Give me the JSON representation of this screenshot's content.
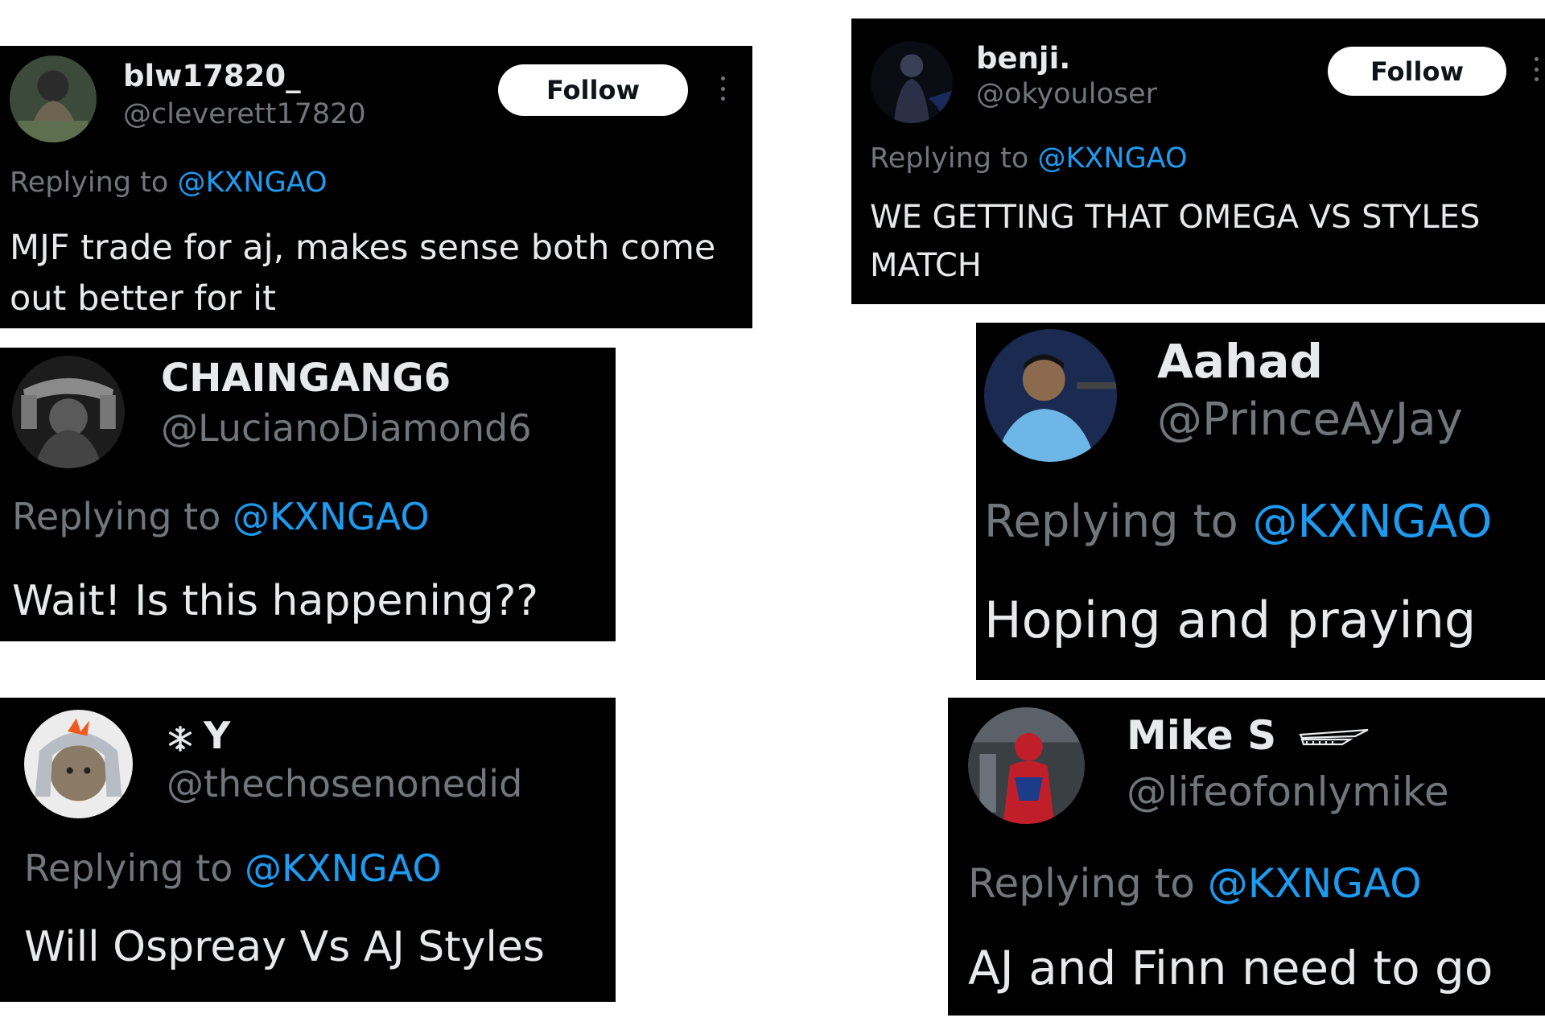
{
  "colors": {
    "card_bg": "#000000",
    "name": "#e7e9ea",
    "handle": "#71767b",
    "mention": "#1d9bf0",
    "follow_bg": "#ffffff",
    "page_bg": "#ffffff"
  },
  "replying_prefix": "Replying to ",
  "posts": [
    {
      "name": "blw17820_",
      "handle": "@cleverett17820",
      "reply_to": "@KXNGAO",
      "text": "MJF trade for aj, makes sense both come out better for it",
      "follow_label": "Follow",
      "avatar_icon": "masked-man-avatar-icon"
    },
    {
      "name": "benji.",
      "handle": "@okyouloser",
      "reply_to": "@KXNGAO",
      "text": "WE GETTING THAT OMEGA VS STYLES MATCH",
      "follow_label": "Follow",
      "avatar_icon": "dark-figure-avatar-icon"
    },
    {
      "name": "CHAINGANG6",
      "handle": "@LucianoDiamond6",
      "reply_to": "@KXNGAO",
      "text": "Wait! Is this happening??",
      "avatar_icon": "wrestler-belt-avatar-icon"
    },
    {
      "name": "Aahad",
      "handle": "@PrinceAyJay",
      "reply_to": "@KXNGAO",
      "text": "Hoping and praying",
      "avatar_icon": "man-blue-shirt-avatar-icon"
    },
    {
      "name": "Y",
      "name_icon": "snowflake-icon",
      "handle": "@thechosenonedid",
      "reply_to": "@KXNGAO",
      "text": "Will Ospreay Vs AJ Styles",
      "avatar_icon": "sackboy-avatar-icon"
    },
    {
      "name": "Mike S",
      "name_icon": "wing-icon",
      "handle": "@lifeofonlymike",
      "reply_to": "@KXNGAO",
      "text": "AJ and Finn need to go",
      "avatar_icon": "spiderman-avatar-icon"
    }
  ]
}
